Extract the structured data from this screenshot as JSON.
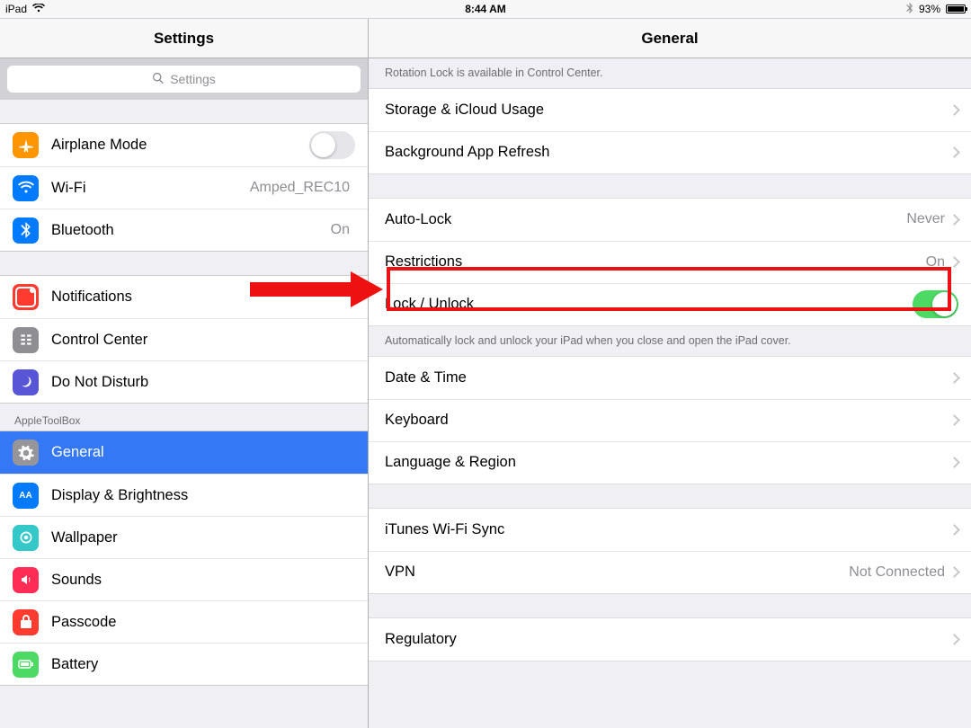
{
  "status": {
    "device": "iPad",
    "time": "8:44 AM",
    "battery_pct": "93%"
  },
  "sidebar": {
    "title": "Settings",
    "search_placeholder": "Settings",
    "groups": [
      {
        "rows": [
          {
            "label": "Airplane Mode",
            "value": "",
            "has_switch": true,
            "switch_on": false
          },
          {
            "label": "Wi-Fi",
            "value": "Amped_REC10"
          },
          {
            "label": "Bluetooth",
            "value": "On"
          }
        ]
      },
      {
        "rows": [
          {
            "label": "Notifications"
          },
          {
            "label": "Control Center"
          },
          {
            "label": "Do Not Disturb"
          }
        ]
      },
      {
        "header": "AppleToolBox",
        "rows": [
          {
            "label": "General",
            "selected": true
          },
          {
            "label": "Display & Brightness"
          },
          {
            "label": "Wallpaper"
          },
          {
            "label": "Sounds"
          },
          {
            "label": "Passcode"
          },
          {
            "label": "Battery"
          }
        ]
      }
    ]
  },
  "detail": {
    "title": "General",
    "hint_top": "Rotation Lock is available in Control Center.",
    "groups": [
      {
        "rows": [
          {
            "label": "Storage & iCloud Usage"
          },
          {
            "label": "Background App Refresh"
          }
        ]
      },
      {
        "rows": [
          {
            "label": "Auto-Lock",
            "value": "Never"
          },
          {
            "label": "Restrictions",
            "value": "On",
            "highlight": true
          },
          {
            "label": "Lock / Unlock",
            "has_switch": true,
            "switch_on": true
          }
        ],
        "footer": "Automatically lock and unlock your iPad when you close and open the iPad cover."
      },
      {
        "rows": [
          {
            "label": "Date & Time"
          },
          {
            "label": "Keyboard"
          },
          {
            "label": "Language & Region"
          }
        ]
      },
      {
        "rows": [
          {
            "label": "iTunes Wi-Fi Sync"
          },
          {
            "label": "VPN",
            "value": "Not Connected"
          }
        ]
      },
      {
        "rows": [
          {
            "label": "Regulatory"
          }
        ]
      }
    ]
  }
}
